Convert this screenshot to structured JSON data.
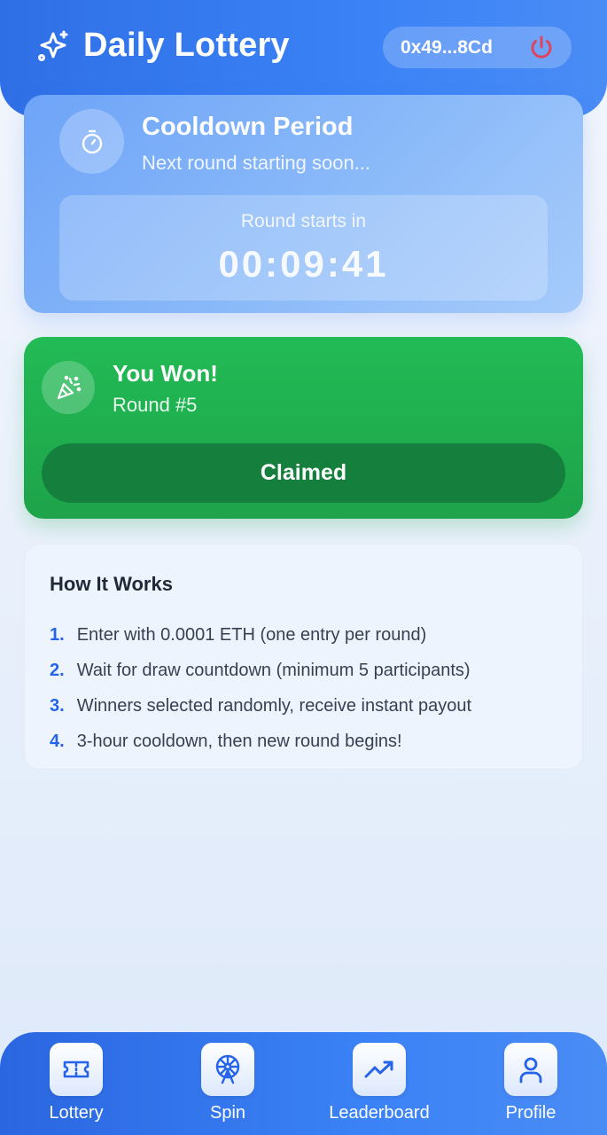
{
  "header": {
    "title": "Daily Lottery",
    "wallet_address": "0x49...8Cd"
  },
  "cooldown": {
    "title": "Cooldown Period",
    "subtitle": "Next round starting soon...",
    "countdown_label": "Round starts in",
    "countdown": "00:09:41"
  },
  "winner": {
    "title": "You Won!",
    "round": "Round #5",
    "button_label": "Claimed"
  },
  "how_it_works": {
    "title": "How It Works",
    "steps": [
      {
        "num": "1.",
        "text": "Enter with 0.0001 ETH (one entry per round)"
      },
      {
        "num": "2.",
        "text": "Wait for draw countdown (minimum 5 participants)"
      },
      {
        "num": "3.",
        "text": "Winners selected randomly, receive instant payout"
      },
      {
        "num": "4.",
        "text": "3-hour cooldown, then new round begins!"
      }
    ]
  },
  "nav": {
    "items": [
      {
        "label": "Lottery",
        "icon": "ticket-icon"
      },
      {
        "label": "Spin",
        "icon": "ferris-wheel-icon"
      },
      {
        "label": "Leaderboard",
        "icon": "trending-up-icon"
      },
      {
        "label": "Profile",
        "icon": "user-icon"
      }
    ]
  },
  "colors": {
    "primary": "#3b82f6",
    "success": "#22bb55",
    "success_dark": "#15803d",
    "danger": "#e0445a"
  }
}
